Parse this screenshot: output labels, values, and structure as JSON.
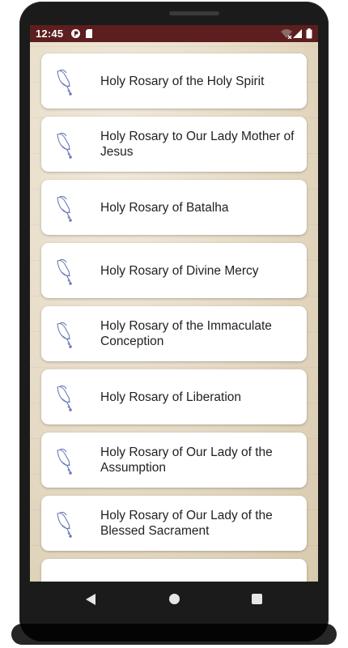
{
  "status_bar": {
    "time": "12:45",
    "left_icons": [
      "data-saver-icon",
      "sd-card-icon"
    ],
    "right_icons": [
      "wifi-off-icon",
      "signal-icon",
      "battery-icon"
    ],
    "color": "#5c1e1e"
  },
  "rosary_list": {
    "items": [
      {
        "label": "Holy Rosary of the Holy Spirit",
        "icon": "praying-hands-rosary-icon"
      },
      {
        "label": "Holy Rosary to Our Lady Mother of Jesus",
        "icon": "praying-hands-rosary-icon"
      },
      {
        "label": "Holy Rosary of Batalha",
        "icon": "praying-hands-rosary-icon"
      },
      {
        "label": "Holy Rosary of Divine Mercy",
        "icon": "praying-hands-rosary-icon"
      },
      {
        "label": "Holy Rosary of the Immaculate Conception",
        "icon": "praying-hands-rosary-icon"
      },
      {
        "label": "Holy Rosary of Liberation",
        "icon": "praying-hands-rosary-icon"
      },
      {
        "label": "Holy Rosary of Our Lady of the Assumption",
        "icon": "praying-hands-rosary-icon"
      },
      {
        "label": "Holy Rosary of Our Lady of the Blessed Sacrament",
        "icon": "praying-hands-rosary-icon"
      }
    ]
  },
  "nav_bar": {
    "buttons": [
      "back-icon",
      "home-icon",
      "recents-icon"
    ]
  }
}
